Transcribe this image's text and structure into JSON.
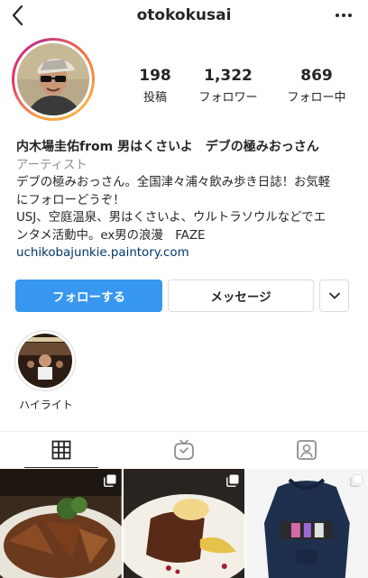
{
  "header": {
    "username": "otokokusai"
  },
  "stats": [
    {
      "value": "198",
      "label": "投稿"
    },
    {
      "value": "1,322",
      "label": "フォロワー"
    },
    {
      "value": "869",
      "label": "フォロー中"
    }
  ],
  "bio": {
    "name": "内木場圭佑from 男はくさいよ　デブの極みおっさん",
    "category": "アーティスト",
    "line1": "デブの極みおっさん。全国津々浦々飲み歩き日誌！お気軽",
    "line2": "にフォローどうぞ！",
    "line3": "USJ、空庭温泉、男はくさいよ、ウルトラソウルなどでエ",
    "line4": "ンタメ活動中。ex男の浪漫　FAZE",
    "link": "uchikobajunkie.paintory.com"
  },
  "buttons": {
    "follow": "フォローする",
    "message": "メッセージ"
  },
  "highlights": [
    {
      "label": "ハイライト"
    }
  ],
  "colors": {
    "follow_button": "#3897f0",
    "link": "#00376b",
    "category": "#8e8e8e"
  },
  "icons": [
    "back-arrow-icon",
    "more-dots-icon",
    "chevron-down-icon",
    "grid-icon",
    "igtv-icon",
    "tagged-icon",
    "multi-post-icon"
  ]
}
